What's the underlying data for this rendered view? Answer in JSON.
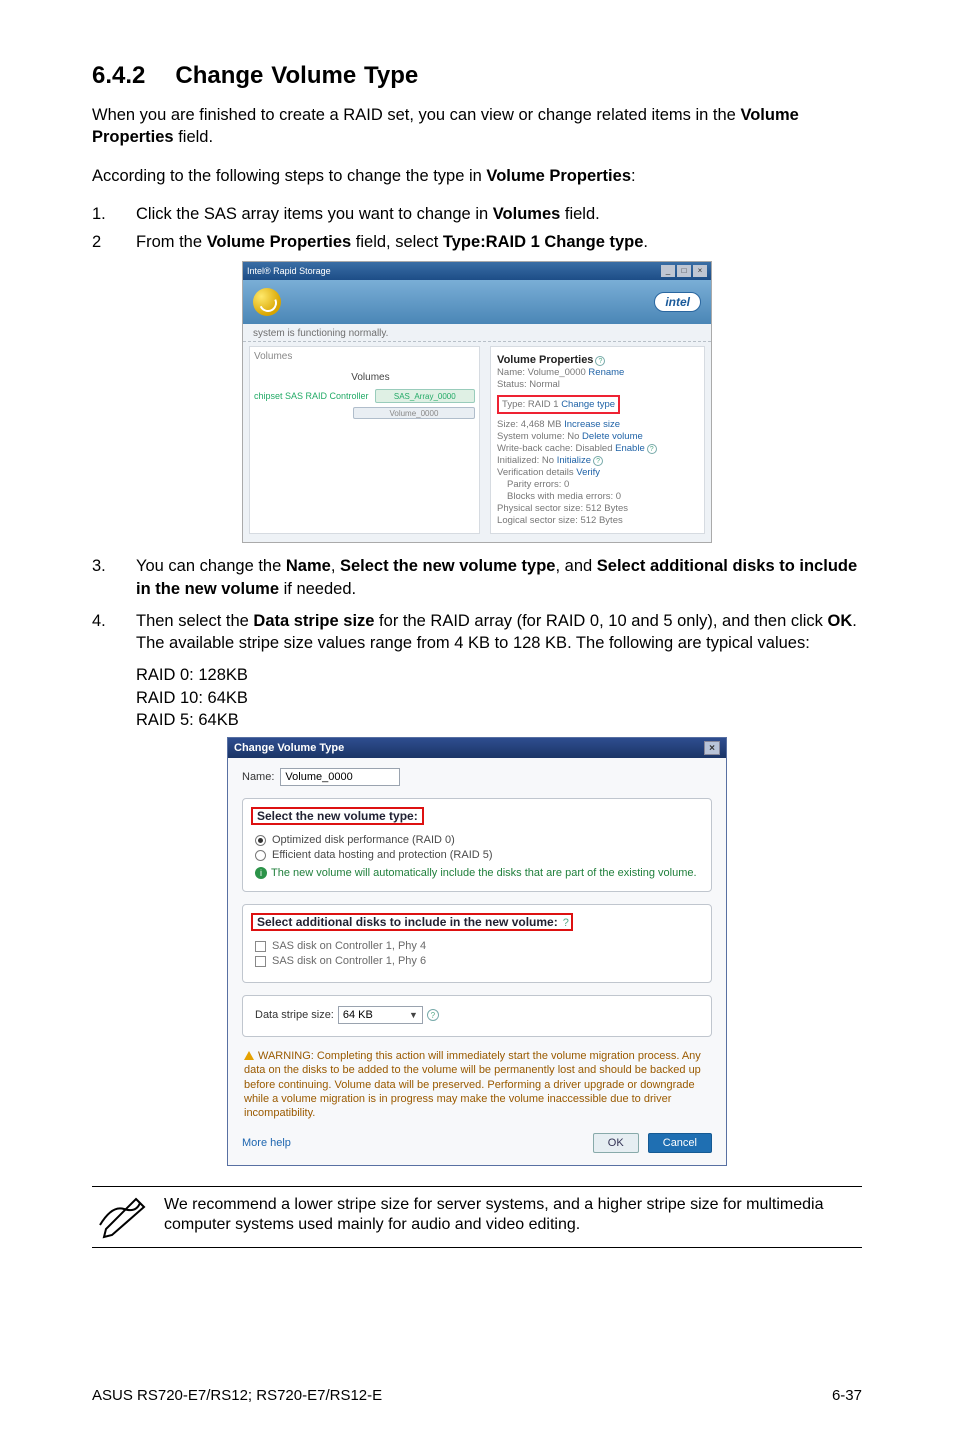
{
  "section": {
    "number": "6.4.2",
    "title": "Change Volume Type"
  },
  "para1_a": "When you are finished to create a RAID set, you can view or change related items in the ",
  "para1_b": "Volume Properties",
  "para1_c": " field.",
  "para2_a": "According to the following steps to change the type in ",
  "para2_b": "Volume Properties",
  "para2_c": ":",
  "steps12": [
    {
      "n": "1.",
      "pre": "Click the SAS array items you want to change in ",
      "b": "Volumes",
      "post": " field."
    },
    {
      "n": "2",
      "pre": "From the ",
      "b1": "Volume Properties",
      "mid": " field, select ",
      "b2": "Type:RAID 1 Change type",
      "post": "."
    }
  ],
  "shot1": {
    "titlebar": "Intel® Rapid Storage",
    "intel": "intel",
    "subhead": "system is functioning normally.",
    "left": {
      "hdr": "Volumes",
      "volumes_label": "Volumes",
      "ctrl": "chipset SAS RAID Controller",
      "bar1": "SAS_Array_0000",
      "bar2": "Volume_0000"
    },
    "right": {
      "title": "Volume Properties",
      "l_name": "Name: Volume_0000 ",
      "l_name_link": "Rename",
      "l_status": "Status: Normal",
      "l_type_label": "Type: RAID 1 ",
      "l_type_link": "Change type",
      "l_size": "Size: 4,468 MB ",
      "l_size_link": "Increase size",
      "l_sys": "System volume: No ",
      "l_sys_link": "Delete volume",
      "l_cache": "Write-back cache: Disabled ",
      "l_cache_link": "Enable",
      "l_init": "Initialized: No ",
      "l_init_link": "Initialize",
      "l_verif": "Verification details ",
      "l_verif_link": "Verify",
      "l_parity": "Parity errors: 0",
      "l_blocks": "Blocks with media errors: 0",
      "l_phys": "Physical sector size: 512 Bytes",
      "l_log": "Logical sector size: 512 Bytes"
    }
  },
  "steps34": {
    "s3": {
      "n": "3.",
      "a": "You can change the ",
      "b1": "Name",
      "b2": "Select the new volume type",
      "b3": "Select additional disks to include in the new volume",
      "post": " if needed."
    },
    "s4": {
      "n": "4.",
      "a": "Then select the ",
      "b1": "Data stripe size",
      "mid": " for the RAID array (for RAID 0, 10 and 5 only), and then click ",
      "b2": "OK",
      "post": ". The available stripe size values range from 4 KB to 128 KB. The following are typical values:"
    }
  },
  "raidlist": {
    "r0": "RAID 0: 128KB",
    "r10": "RAID 10: 64KB",
    "r5": "RAID 5: 64KB"
  },
  "shot2": {
    "title": "Change Volume Type",
    "name_label": "Name:",
    "name_value": "Volume_0000",
    "fs1_legend": "Select the new volume type:",
    "opt1": "Optimized disk performance (RAID 0)",
    "opt2": "Efficient data hosting and protection (RAID 5)",
    "info": "The new volume will automatically include the disks that are part of the existing volume.",
    "fs2_legend": "Select additional disks to include in the new volume:",
    "disk1": "SAS disk on Controller 1, Phy 4",
    "disk2": "SAS disk on Controller 1, Phy 6",
    "stripe_label": "Data stripe size:",
    "stripe_value": "64 KB",
    "warn": "WARNING: Completing this action will immediately start the volume migration process. Any data on the disks to be added to the volume will be permanently lost and should be backed up before continuing. Volume data will be preserved. Performing a driver upgrade or downgrade while a volume migration is in progress may make the volume inaccessible due to driver incompatibility.",
    "help": "More help",
    "ok": "OK",
    "cancel": "Cancel"
  },
  "note": "We recommend a lower stripe size for server systems, and a higher stripe size for multimedia computer systems used mainly for audio and video editing.",
  "footer": {
    "left": "ASUS RS720-E7/RS12; RS720-E7/RS12-E",
    "right": "6-37"
  }
}
